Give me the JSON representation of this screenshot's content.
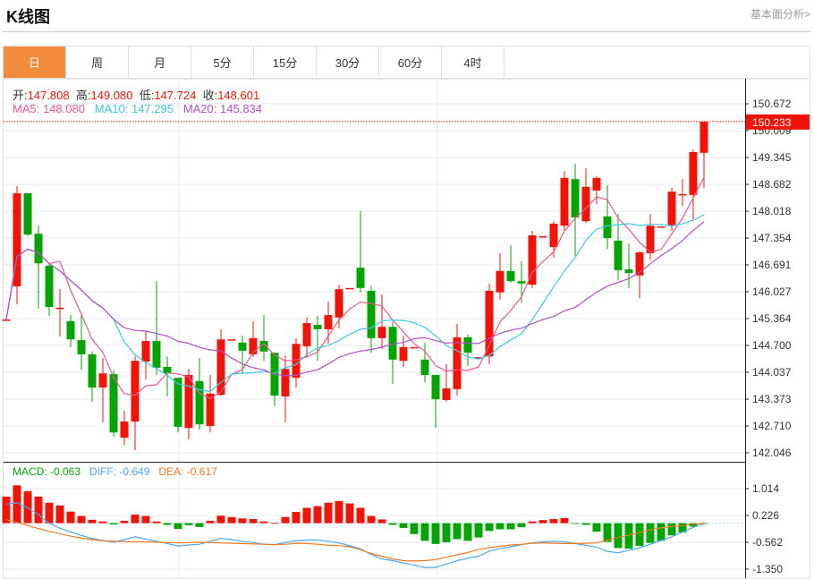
{
  "header": {
    "title": "K线图",
    "link": "基本面分析>"
  },
  "tabs": [
    {
      "label": "日",
      "active": true
    },
    {
      "label": "周"
    },
    {
      "label": "月"
    },
    {
      "label": "5分"
    },
    {
      "label": "15分"
    },
    {
      "label": "30分"
    },
    {
      "label": "60分"
    },
    {
      "label": "4时"
    }
  ],
  "ohlc_legend": {
    "open_label": "开:",
    "open": "147.808",
    "high_label": "高:",
    "high": "149.080",
    "low_label": "低:",
    "low": "147.724",
    "close_label": "收:",
    "close": "148.601"
  },
  "ma_legend": {
    "ma5": "MA5: 148.080",
    "ma10": "MA10: 147.295",
    "ma20": "MA20: 145.834"
  },
  "macd_legend": {
    "macd": "MACD: -0.063",
    "diff": "DIFF: -0.649",
    "dea": "DEA: -0.617"
  },
  "colors": {
    "up": "#f01408",
    "down": "#04a404",
    "ma5": "#f0578a",
    "ma10": "#3cc8e0",
    "ma20": "#b14ec8",
    "diff": "#4ba8f0",
    "dea": "#f07a1e",
    "accent": "#f28b3c"
  },
  "chart_data": [
    {
      "type": "candlestick",
      "title": "K线图",
      "ylim": [
        142.046,
        150.672
      ],
      "yticks": [
        "150.672",
        "150.009",
        "149.345",
        "148.682",
        "148.018",
        "147.354",
        "146.691",
        "146.027",
        "145.364",
        "144.700",
        "144.037",
        "143.373",
        "142.710",
        "142.046"
      ],
      "last_price": "150.233",
      "ohlc": [
        [
          145.34,
          145.34,
          145.34,
          145.34
        ],
        [
          146.16,
          148.64,
          145.72,
          148.46
        ],
        [
          148.46,
          148.46,
          147.4,
          147.44
        ],
        [
          147.46,
          147.66,
          145.61,
          146.73
        ],
        [
          146.67,
          146.73,
          145.43,
          145.65
        ],
        [
          145.63,
          146.09,
          144.92,
          145.63
        ],
        [
          145.3,
          145.45,
          144.66,
          144.85
        ],
        [
          144.83,
          145.5,
          144.1,
          144.48
        ],
        [
          144.48,
          144.55,
          143.31,
          143.66
        ],
        [
          143.66,
          144.39,
          142.8,
          144.01
        ],
        [
          143.99,
          144.08,
          142.44,
          142.55
        ],
        [
          142.42,
          143.09,
          142.24,
          142.82
        ],
        [
          142.82,
          144.43,
          142.11,
          144.32
        ],
        [
          144.3,
          145.08,
          143.86,
          144.81
        ],
        [
          144.81,
          146.29,
          143.97,
          144.15
        ],
        [
          144.17,
          144.43,
          143.44,
          144.01
        ],
        [
          143.9,
          143.9,
          142.55,
          142.69
        ],
        [
          142.66,
          144.12,
          142.38,
          143.97
        ],
        [
          143.82,
          144.39,
          142.62,
          142.75
        ],
        [
          142.71,
          143.97,
          142.55,
          143.51
        ],
        [
          143.48,
          145.1,
          143.46,
          144.85
        ],
        [
          144.85,
          144.85,
          144.85,
          144.85
        ],
        [
          144.77,
          144.94,
          143.99,
          144.57
        ],
        [
          144.48,
          145.3,
          144.41,
          144.88
        ],
        [
          144.81,
          145.45,
          144.32,
          144.55
        ],
        [
          144.52,
          144.52,
          143.2,
          143.46
        ],
        [
          143.44,
          144.46,
          142.8,
          144.12
        ],
        [
          143.9,
          144.88,
          143.66,
          144.74
        ],
        [
          144.68,
          145.39,
          144.39,
          145.25
        ],
        [
          145.21,
          145.43,
          144.32,
          145.1
        ],
        [
          145.1,
          145.78,
          144.74,
          145.45
        ],
        [
          145.39,
          146.2,
          145.12,
          146.09
        ],
        [
          146.12,
          146.12,
          146.12,
          146.12
        ],
        [
          146.62,
          148.02,
          146.01,
          146.12
        ],
        [
          146.05,
          146.18,
          144.52,
          144.88
        ],
        [
          144.88,
          145.96,
          144.61,
          145.16
        ],
        [
          145.16,
          145.28,
          143.75,
          144.35
        ],
        [
          144.32,
          144.94,
          144.17,
          144.66
        ],
        [
          144.66,
          144.66,
          144.66,
          144.66
        ],
        [
          144.35,
          144.77,
          143.79,
          143.97
        ],
        [
          143.97,
          143.97,
          142.66,
          143.37
        ],
        [
          143.35,
          144.24,
          143.31,
          143.64
        ],
        [
          143.62,
          145.23,
          143.46,
          144.9
        ],
        [
          144.9,
          144.97,
          144.19,
          144.52
        ],
        [
          144.41,
          144.41,
          144.41,
          144.41
        ],
        [
          144.43,
          146.23,
          144.24,
          146.05
        ],
        [
          146.01,
          146.98,
          145.83,
          146.54
        ],
        [
          146.54,
          147.18,
          146.25,
          146.29
        ],
        [
          146.29,
          146.78,
          145.76,
          146.23
        ],
        [
          146.2,
          147.53,
          146.12,
          147.42
        ],
        [
          147.4,
          147.4,
          147.4,
          147.4
        ],
        [
          147.13,
          147.77,
          146.87,
          147.71
        ],
        [
          147.66,
          149.01,
          147.55,
          148.84
        ],
        [
          148.81,
          149.19,
          146.91,
          147.86
        ],
        [
          147.77,
          149.08,
          147.73,
          148.62
        ],
        [
          148.53,
          148.88,
          148.19,
          148.84
        ],
        [
          147.89,
          148.66,
          147.09,
          147.35
        ],
        [
          147.29,
          147.95,
          146.31,
          146.56
        ],
        [
          146.58,
          147.22,
          146.12,
          146.49
        ],
        [
          146.43,
          147.02,
          145.87,
          147.0
        ],
        [
          146.98,
          147.95,
          146.82,
          147.66
        ],
        [
          147.64,
          147.64,
          147.64,
          147.64
        ],
        [
          147.66,
          148.59,
          147.53,
          148.5
        ],
        [
          148.44,
          148.81,
          148.15,
          148.44
        ],
        [
          148.42,
          149.54,
          147.82,
          149.48
        ],
        [
          149.46,
          150.23,
          148.59,
          150.23
        ]
      ],
      "ma_periods": [
        5,
        10,
        20
      ]
    },
    {
      "type": "bar+line",
      "title": "MACD",
      "yticks": [
        "1.014",
        "0.226",
        "-0.562",
        "-1.350"
      ],
      "ylim": [
        -1.35,
        1.014
      ],
      "macd": [
        0.78,
        1.11,
        0.94,
        0.78,
        0.6,
        0.52,
        0.34,
        0.21,
        0.1,
        0.05,
        -0.04,
        0.07,
        0.25,
        0.21,
        0.05,
        -0.05,
        -0.17,
        -0.06,
        -0.11,
        0.07,
        0.22,
        0.18,
        0.14,
        0.12,
        0.05,
        0.01,
        0.18,
        0.33,
        0.45,
        0.5,
        0.6,
        0.65,
        0.58,
        0.45,
        0.21,
        0.11,
        -0.05,
        -0.14,
        -0.32,
        -0.52,
        -0.61,
        -0.56,
        -0.47,
        -0.52,
        -0.42,
        -0.23,
        -0.18,
        -0.18,
        -0.12,
        0.05,
        0.09,
        0.12,
        0.15,
        -0.02,
        -0.05,
        -0.25,
        -0.55,
        -0.73,
        -0.75,
        -0.67,
        -0.58,
        -0.52,
        -0.36,
        -0.27,
        -0.1,
        -0.02
      ],
      "diff": [
        0.56,
        0.6,
        0.45,
        0.25,
        0.0,
        -0.15,
        -0.26,
        -0.36,
        -0.45,
        -0.51,
        -0.56,
        -0.48,
        -0.4,
        -0.47,
        -0.53,
        -0.6,
        -0.67,
        -0.64,
        -0.62,
        -0.53,
        -0.45,
        -0.48,
        -0.53,
        -0.57,
        -0.62,
        -0.63,
        -0.57,
        -0.51,
        -0.5,
        -0.49,
        -0.53,
        -0.58,
        -0.66,
        -0.75,
        -0.92,
        -1.05,
        -1.1,
        -1.17,
        -1.23,
        -1.3,
        -1.3,
        -1.2,
        -1.1,
        -1.03,
        -0.97,
        -0.82,
        -0.75,
        -0.69,
        -0.63,
        -0.58,
        -0.55,
        -0.53,
        -0.54,
        -0.6,
        -0.65,
        -0.7,
        -0.83,
        -0.87,
        -0.8,
        -0.72,
        -0.62,
        -0.51,
        -0.4,
        -0.26,
        -0.12,
        -0.02
      ],
      "dea": [
        0.1,
        0.02,
        -0.07,
        -0.16,
        -0.24,
        -0.31,
        -0.38,
        -0.44,
        -0.48,
        -0.52,
        -0.53,
        -0.54,
        -0.55,
        -0.55,
        -0.56,
        -0.57,
        -0.58,
        -0.57,
        -0.56,
        -0.57,
        -0.58,
        -0.59,
        -0.6,
        -0.61,
        -0.62,
        -0.63,
        -0.62,
        -0.59,
        -0.6,
        -0.62,
        -0.65,
        -0.66,
        -0.69,
        -0.78,
        -0.89,
        -0.97,
        -1.05,
        -1.1,
        -1.11,
        -1.1,
        -1.07,
        -1.0,
        -0.93,
        -0.86,
        -0.77,
        -0.72,
        -0.68,
        -0.64,
        -0.62,
        -0.59,
        -0.58,
        -0.59,
        -0.6,
        -0.6,
        -0.59,
        -0.58,
        -0.5,
        -0.42,
        -0.35,
        -0.28,
        -0.2,
        -0.14,
        -0.1,
        -0.07,
        -0.03,
        0.0
      ]
    }
  ]
}
